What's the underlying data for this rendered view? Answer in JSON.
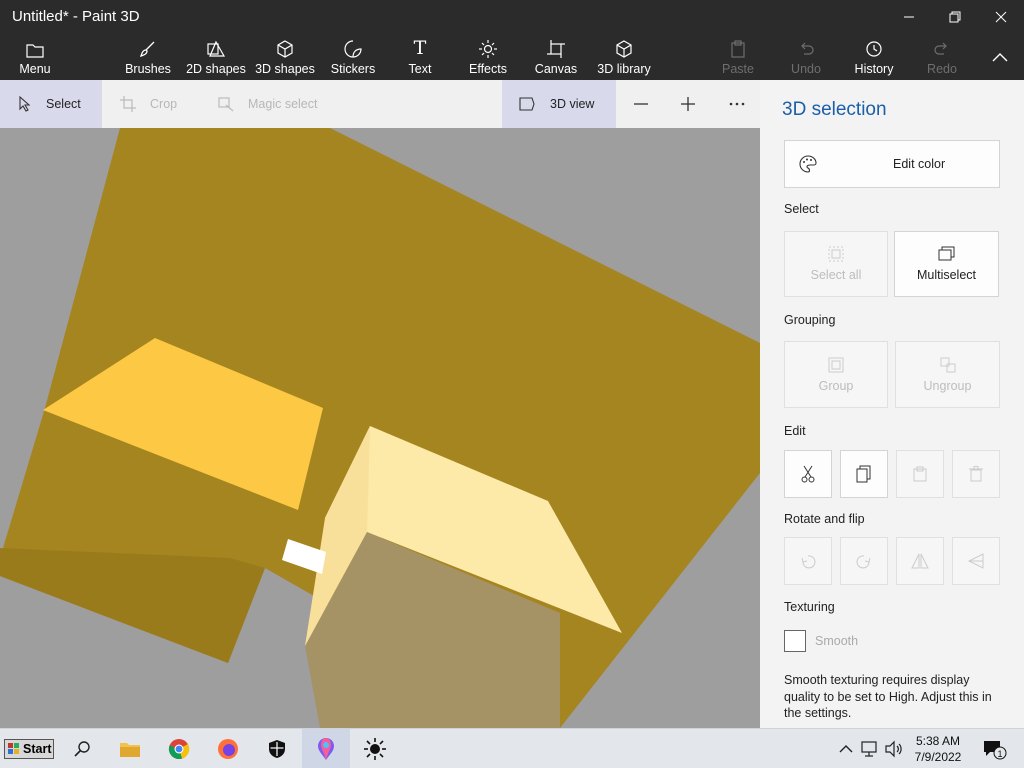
{
  "window": {
    "title": "Untitled* - Paint 3D"
  },
  "ribbon": {
    "menu": "Menu",
    "brushes": "Brushes",
    "shapes2d": "2D shapes",
    "shapes3d": "3D shapes",
    "stickers": "Stickers",
    "text": "Text",
    "effects": "Effects",
    "canvas": "Canvas",
    "library": "3D library",
    "paste": "Paste",
    "undo": "Undo",
    "history": "History",
    "redo": "Redo"
  },
  "toolbar": {
    "select": "Select",
    "crop": "Crop",
    "magic_select": "Magic select",
    "view3d": "3D view"
  },
  "panel": {
    "title": "3D selection",
    "edit_color": "Edit color",
    "select_section": "Select",
    "select_all": "Select all",
    "multiselect": "Multiselect",
    "grouping_section": "Grouping",
    "group": "Group",
    "ungroup": "Ungroup",
    "edit_section": "Edit",
    "rotate_section": "Rotate and flip",
    "texturing_section": "Texturing",
    "smooth": "Smooth",
    "note": "Smooth texturing requires display quality to be set to High. Adjust this in the settings."
  },
  "taskbar": {
    "start": "Start",
    "time": "5:38 AM",
    "date": "7/9/2022",
    "notification_count": "1"
  },
  "colors": {
    "ribbon_bg": "#2b2b2b",
    "accent": "#1a5fa8",
    "canvas_bg": "#9e9e9e",
    "model_dark": "#a5851f",
    "model_light": "#fdd24a",
    "model_pale": "#fde9a8"
  }
}
